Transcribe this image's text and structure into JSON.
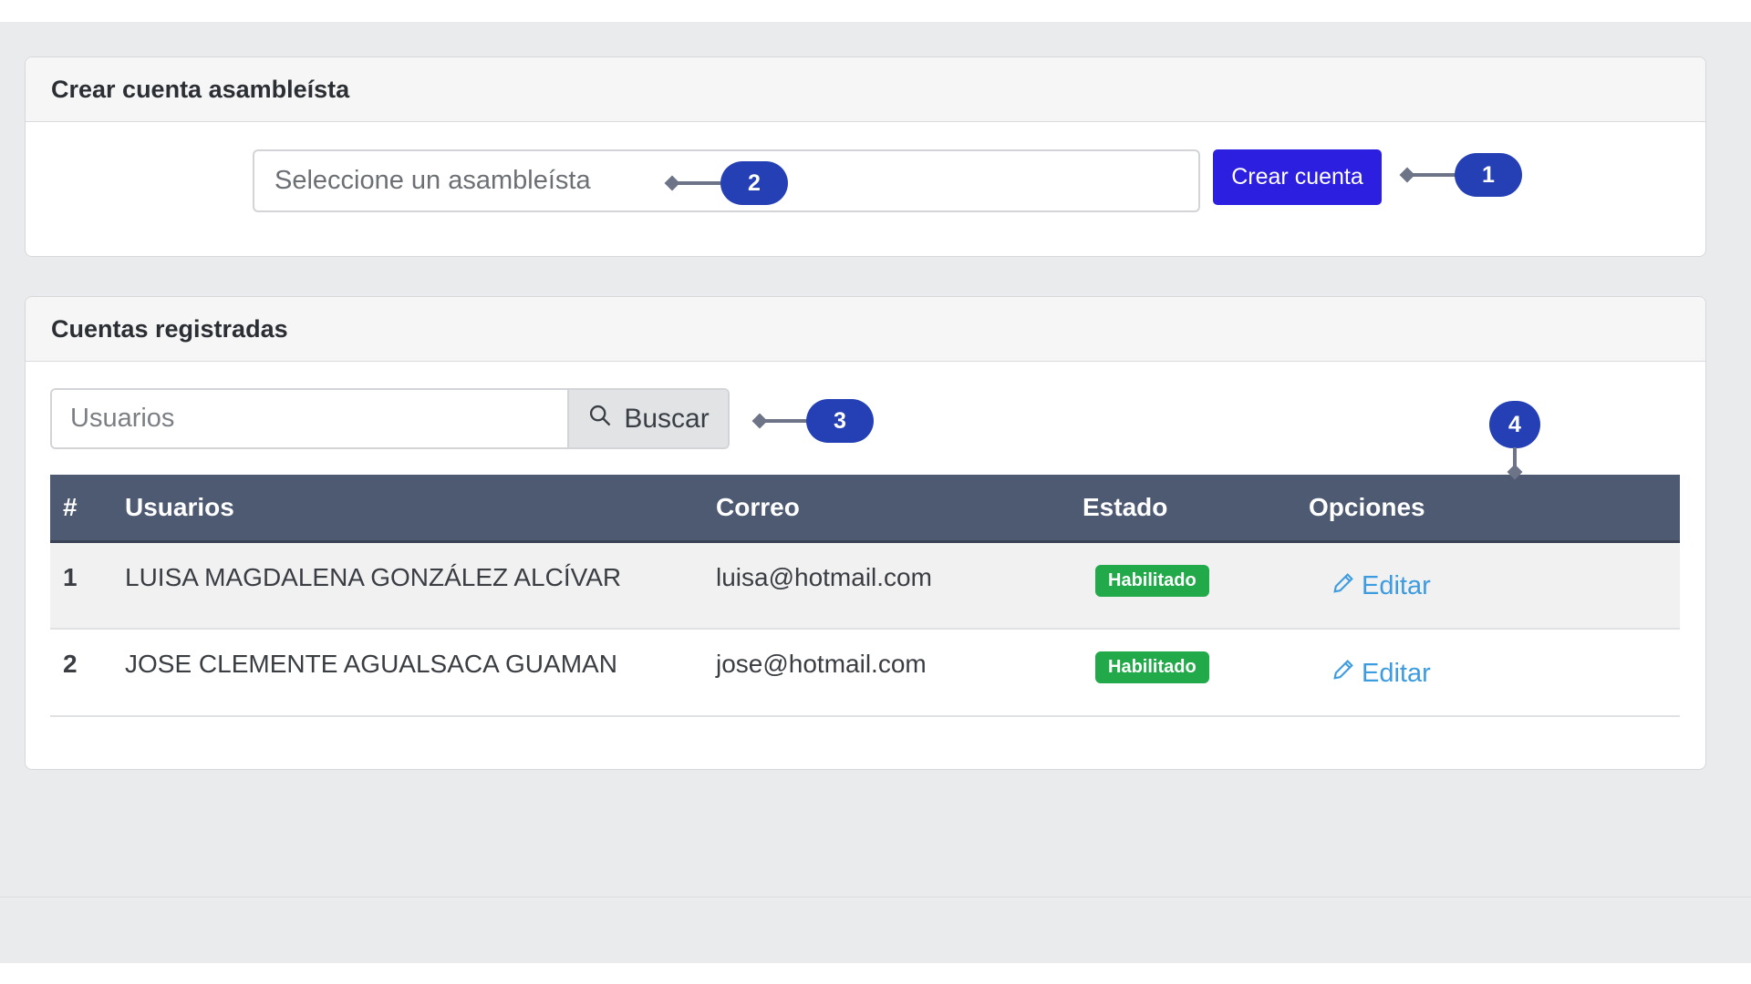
{
  "create_card": {
    "title": "Crear cuenta asambleísta",
    "select_placeholder": "Seleccione un asambleísta",
    "create_button": "Crear cuenta"
  },
  "list_card": {
    "title": "Cuentas registradas",
    "search_placeholder": "Usuarios",
    "search_button": "Buscar",
    "columns": [
      "#",
      "Usuarios",
      "Correo",
      "Estado",
      "Opciones"
    ],
    "rows": [
      {
        "index": "1",
        "name": "LUISA MAGDALENA GONZÁLEZ ALCÍVAR",
        "email": "luisa@hotmail.com",
        "status": "Habilitado",
        "action": "Editar"
      },
      {
        "index": "2",
        "name": "JOSE CLEMENTE AGUALSACA GUAMAN",
        "email": "jose@hotmail.com",
        "status": "Habilitado",
        "action": "Editar"
      }
    ]
  },
  "callouts": {
    "c1": "1",
    "c2": "2",
    "c3": "3",
    "c4": "4"
  },
  "colors": {
    "primary_button": "#2d1fe0",
    "table_header": "#4d5a72",
    "badge_success": "#22a94a",
    "link": "#3d9be0",
    "callout": "#2540b4"
  },
  "icons": {
    "search": "search-icon",
    "edit": "pencil-icon"
  }
}
